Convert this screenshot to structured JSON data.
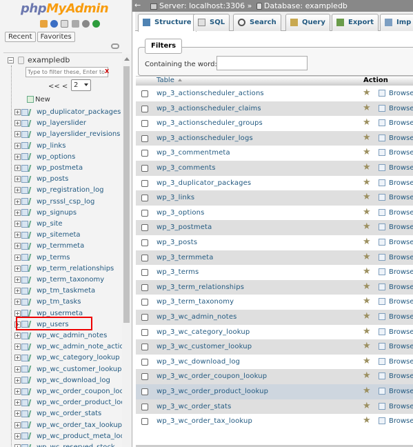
{
  "logo": {
    "php": "php",
    "myadmin": "MyAdmin"
  },
  "nav": {
    "recent_label": "Recent",
    "favorites_label": "Favorites",
    "db_expander": "−",
    "database": "exampledb",
    "filter_placeholder": "Type to filter these, Enter to search",
    "filter_clear": "X",
    "pager_prev": "<< <",
    "pager_value": "2",
    "new_label": "New",
    "highlighted_item": "wp_users",
    "tables": [
      "wp_duplicator_packages",
      "wp_layerslider",
      "wp_layerslider_revisions",
      "wp_links",
      "wp_options",
      "wp_postmeta",
      "wp_posts",
      "wp_registration_log",
      "wp_rsssl_csp_log",
      "wp_signups",
      "wp_site",
      "wp_sitemeta",
      "wp_termmeta",
      "wp_terms",
      "wp_term_relationships",
      "wp_term_taxonomy",
      "wp_tm_taskmeta",
      "wp_tm_tasks",
      "wp_usermeta",
      "wp_users",
      "wp_wc_admin_notes",
      "wp_wc_admin_note_actio",
      "wp_wc_category_lookup",
      "wp_wc_customer_lookup",
      "wp_wc_download_log",
      "wp_wc_order_coupon_loo",
      "wp_wc_order_product_loo",
      "wp_wc_order_stats",
      "wp_wc_order_tax_lookup",
      "wp_wc_product_meta_loo",
      "wp_wc_reserved_stock"
    ]
  },
  "breadcrumb": {
    "back": "←",
    "server": "Server: localhost:3306",
    "separator": "»",
    "database": "Database: exampledb"
  },
  "tabs": [
    {
      "label": "Structure",
      "icon": "structure-icon"
    },
    {
      "label": "SQL",
      "icon": "sql-icon"
    },
    {
      "label": "Search",
      "icon": "search-icon"
    },
    {
      "label": "Query",
      "icon": "query-icon"
    },
    {
      "label": "Export",
      "icon": "export-icon"
    },
    {
      "label": "Imp",
      "icon": "import-icon"
    }
  ],
  "filters": {
    "legend": "Filters",
    "containing_label": "Containing the word:",
    "value": ""
  },
  "table_header": {
    "table": "Table",
    "action": "Action"
  },
  "browse_label": "Browse",
  "rows": [
    "wp_3_actionscheduler_actions",
    "wp_3_actionscheduler_claims",
    "wp_3_actionscheduler_groups",
    "wp_3_actionscheduler_logs",
    "wp_3_commentmeta",
    "wp_3_comments",
    "wp_3_duplicator_packages",
    "wp_3_links",
    "wp_3_options",
    "wp_3_postmeta",
    "wp_3_posts",
    "wp_3_termmeta",
    "wp_3_terms",
    "wp_3_term_relationships",
    "wp_3_term_taxonomy",
    "wp_3_wc_admin_notes",
    "wp_3_wc_category_lookup",
    "wp_3_wc_customer_lookup",
    "wp_3_wc_download_log",
    "wp_3_wc_order_coupon_lookup",
    "wp_3_wc_order_product_lookup",
    "wp_3_wc_order_stats",
    "wp_3_wc_order_tax_lookup"
  ],
  "hovered_row": "wp_3_wc_order_product_lookup"
}
